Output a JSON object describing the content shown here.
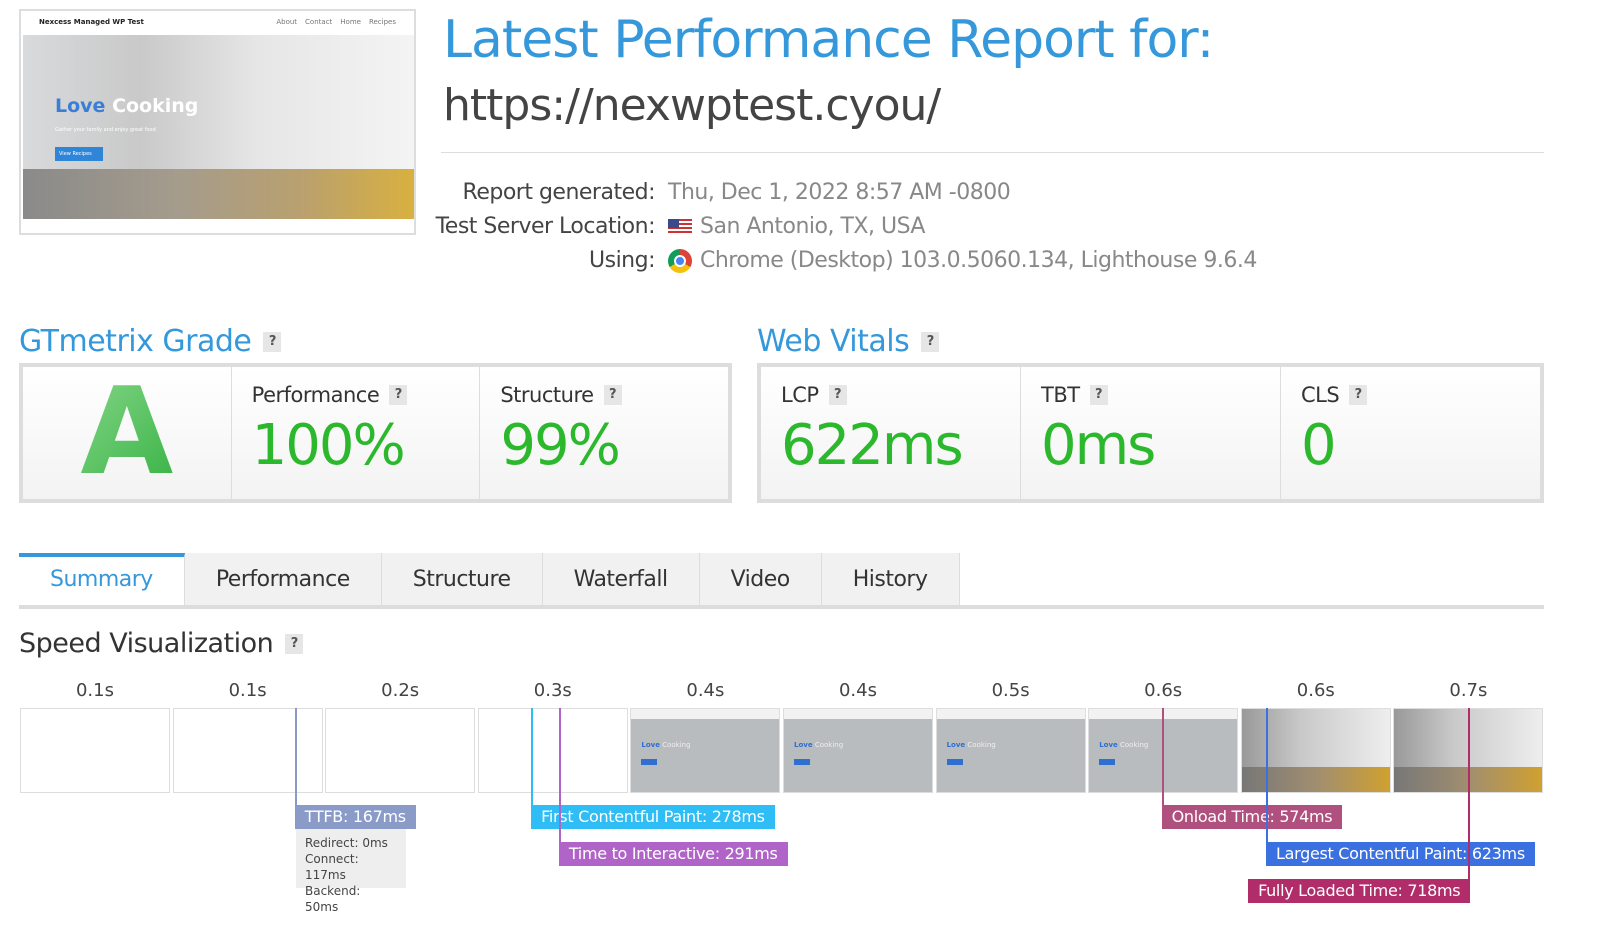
{
  "preview": {
    "site_name": "Nexcess Managed WP Test",
    "nav": [
      "About",
      "Contact",
      "Home",
      "Recipes"
    ],
    "hero_highlight": "Love",
    "hero_title": "Cooking",
    "hero_sub": "Gather your family and enjoy great food",
    "button": "View Recipes"
  },
  "header": {
    "title": "Latest Performance Report for:",
    "url": "https://nexwptest.cyou/"
  },
  "meta": [
    {
      "label": "Report generated:",
      "value": "Thu, Dec 1, 2022 8:57 AM -0800",
      "icon": ""
    },
    {
      "label": "Test Server Location:",
      "value": "San Antonio, TX, USA",
      "icon": "us-flag-icon"
    },
    {
      "label": "Using:",
      "value": "Chrome (Desktop) 103.0.5060.134, Lighthouse 9.6.4",
      "icon": "chrome-icon"
    }
  ],
  "grade": {
    "title": "GTmetrix Grade",
    "help": "?",
    "letter": "A",
    "performance_label": "Performance",
    "performance": "100%",
    "structure_label": "Structure",
    "structure": "99%"
  },
  "vitals": {
    "title": "Web Vitals",
    "help": "?",
    "items": [
      {
        "label": "LCP",
        "value": "622ms"
      },
      {
        "label": "TBT",
        "value": "0ms"
      },
      {
        "label": "CLS",
        "value": "0"
      }
    ]
  },
  "tabs": [
    "Summary",
    "Performance",
    "Structure",
    "Waterfall",
    "Video",
    "History"
  ],
  "active_tab": "Summary",
  "speed": {
    "title": "Speed Visualization",
    "help": "?",
    "frames": [
      {
        "time": "0.1s",
        "state": "blank"
      },
      {
        "time": "0.1s",
        "state": "blank"
      },
      {
        "time": "0.2s",
        "state": "blank"
      },
      {
        "time": "0.3s",
        "state": "blank"
      },
      {
        "time": "0.4s",
        "state": "partial"
      },
      {
        "time": "0.4s",
        "state": "partial"
      },
      {
        "time": "0.5s",
        "state": "partial"
      },
      {
        "time": "0.6s",
        "state": "partial"
      },
      {
        "time": "0.6s",
        "state": "full"
      },
      {
        "time": "0.7s",
        "state": "full"
      }
    ],
    "markers": [
      {
        "label": "TTFB: 167ms",
        "ms": 167,
        "color": "#8b9bc8"
      },
      {
        "label": "First Contentful Paint: 278ms",
        "ms": 278,
        "color": "#2fbdf5"
      },
      {
        "label": "Time to Interactive: 291ms",
        "ms": 291,
        "color": "#b064c8"
      },
      {
        "label": "Onload Time: 574ms",
        "ms": 574,
        "color": "#b0507e"
      },
      {
        "label": "Largest Contentful Paint: 623ms",
        "ms": 623,
        "color": "#3b70e0"
      },
      {
        "label": "Fully Loaded Time: 718ms",
        "ms": 718,
        "color": "#b02d6a"
      }
    ],
    "ttfb_details": [
      "Redirect: 0ms",
      "Connect: 117ms",
      "Backend: 50ms"
    ]
  },
  "colors": {
    "accent": "#3498db",
    "good": "#2cb82c"
  }
}
